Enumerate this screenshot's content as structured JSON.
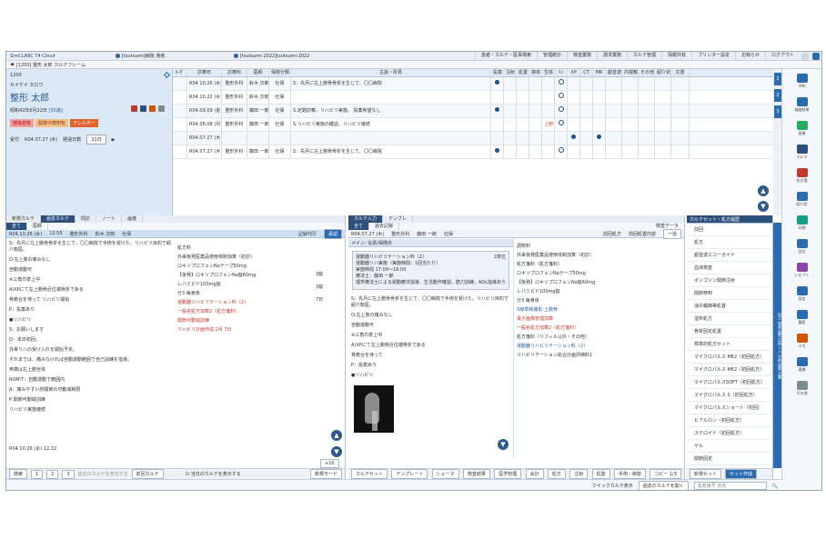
{
  "titlebar": {
    "app": "SimCLINIC T4 Cloud",
    "facility": "[tsutsumi]病院 港南",
    "tenant": "[tsutsumi-2022]tsutsumi-2022",
    "menus": [
      "患者・カルテ・医事検索",
      "管理統計",
      "検査業務",
      "請求業務",
      "カルテ管理",
      "情報共有",
      "プリンター設定",
      "お知らせ",
      "ログアウト"
    ]
  },
  "subbar": {
    "label": "[1200] 整形 太郎 カルテフレーム"
  },
  "patient": {
    "id": "1200",
    "kana": "セイケイ タロウ",
    "name": "整形 太郎",
    "dob": "昭和42年6月22日",
    "age": "[55歳]",
    "tags": [
      "感染症有",
      "服薬中薬剤有",
      "アレルギー"
    ],
    "visit_label": "受付",
    "visit_date": "R04.07.27 (木)",
    "days_label": "経過日数",
    "days": "31日"
  },
  "visits": {
    "headers": [
      "ｵｰﾀﾞ",
      "診療日",
      "診療科",
      "医師",
      "保険分類",
      "主訴・所見",
      "投薬",
      "注射",
      "処置",
      "検体",
      "生体",
      "ﾘﾊ",
      "XP",
      "CT",
      "MR",
      "超音波",
      "内視鏡",
      "その他",
      "紹介状",
      "文書"
    ],
    "rows": [
      {
        "date": "R04.10.26 (水)",
        "dept": "整形外科",
        "doctor": "鈴木 次郎",
        "ins": "社保",
        "note": "S：先月に左上腕骨骨折を生じて、〇〇病院",
        "marks": {
          "投薬": "dot",
          "ﾘﾊ": "ring"
        }
      },
      {
        "date": "R04.10.22 (水)",
        "dept": "整形外科",
        "doctor": "鈴木 次郎",
        "ins": "社保",
        "note": "",
        "marks": {
          "ﾘﾊ": "ring"
        }
      },
      {
        "date": "R04.09.09 (金)",
        "dept": "整形外科",
        "doctor": "藤田 一郎",
        "ins": "社保",
        "note": "S:定期診察。リハビリ実施。 投薬希望なし",
        "marks": {
          "投薬": "dot",
          "ﾘﾊ": "ring"
        }
      },
      {
        "date": "R04.08.08 (月)",
        "dept": "整形外科",
        "doctor": "藤田 一郎",
        "ins": "社保",
        "note": "S:リハビリ実施の確認。リハビリ継続",
        "marks": {
          "生体": "red",
          "ﾘﾊ": "ring"
        }
      },
      {
        "date": "R04.07.27 (木)",
        "dept": "",
        "doctor": "",
        "ins": "",
        "note": "",
        "marks": {
          "XP": "dot",
          "MR": "dot"
        }
      },
      {
        "date": "R04.07.27 (木)",
        "dept": "整形外科",
        "doctor": "藤田 一郎",
        "ins": "社保",
        "note": "S：先月に左上腕骨骨折を生じて、〇〇病院",
        "marks": {
          "投薬": "dot",
          "ﾘﾊ": "ring"
        }
      }
    ],
    "red_text": "上腕骨"
  },
  "leftpane": {
    "tabs": [
      "新規カルテ",
      "過去カルテ",
      "問診",
      "ノート",
      "画像"
    ],
    "subtabs": [
      "全て",
      "医師"
    ],
    "header": {
      "date": "R04.10.26 (水)",
      "time": "12:55",
      "dept": "整形外科",
      "doctor": "鈴木 次郎",
      "ins": "社保",
      "proxy": "記録代行",
      "stamp": "承認"
    },
    "soap": [
      "S：先月に左上腕骨骨折を生じて、〇〇病院で手術を受けた。リハビリ目的で紹介転医。",
      "O:左上肢の痛みなし",
      "自動運動可",
      "※三角巾挙上中",
      "A)XPにて左上腕骨近位端骨折である",
      "骨癒合を待って リハビリ開始",
      "P：投薬あり",
      "●リハビリ",
      "S：お願いします",
      "O：本日初回。",
      "外来リハの受け入れを開始予定。",
      "それまでは、痛みなければ自動運動範囲で自己訓練を指導。",
      "疼痛は左上腕全体",
      "ROM-T：自動運動で範囲内",
      "A：痛みやすい肘関節の可動域制限",
      "P:関節可動域訓練",
      "リハビリ実施継続"
    ],
    "orders": [
      "処方料",
      "外来後発医薬品使用体制加算（初診）",
      "ロキソプロフェンNaテープ50mg",
      "【後発】ロキソプロフェンNa錠60mg",
      "レバミピド100mg錠",
      "分3 毎食後",
      "運動器リハビリテーション料（2）",
      "一般名処方加算2（処方箋料）",
      "関節可動域訓練",
      "リハビリ計画作成 2月 7日"
    ],
    "order_counts": [
      "3錠",
      "3錠",
      "7日"
    ],
    "footer_date": "R04.10.26 (水) 12:22",
    "footer": [
      "検索",
      "1",
      "2",
      "3",
      "過去のカルテを表示する",
      "前回カルテ",
      "新規モード"
    ],
    "plus10": "+10",
    "checkbox": "当日のカルテを表示する"
  },
  "midpane": {
    "tabs": [
      "カルテ入力",
      "テンプレ"
    ],
    "subtabs": [
      "全て",
      "過去記録"
    ],
    "subtab_right": "検査データ",
    "header": {
      "date": "R04.07.27 (木)",
      "dept": "整形外科",
      "doctor": "藤田 一郎",
      "ins": "社保"
    },
    "header_right": [
      "前回処方",
      "前回処置内容",
      "一括"
    ],
    "accordion": "メイン: 伝票/保険外",
    "card": {
      "title": "運動器リハビリテーション料（2）",
      "count": "2単位",
      "lines": [
        "運動器リハ実施（実施時間：1回当たり）",
        "実施時間 17:00〜18:00",
        "療法士：藤田 一郎",
        "理学療法士による運動療法指導、生活動作確認、筋力訓練。ADL指導あり"
      ]
    },
    "soap": [
      "S：先月に左上腕骨骨折を生じて、〇〇病院で手術を受けた。リハビリ目的で紹介転医。",
      "O:左上肢の痛みなし",
      "自動運動可",
      "※三角巾挙上中",
      "A)XPにて左上腕骨近位端骨折である",
      "骨癒合を待って",
      "P：投薬あり",
      "●リハビリ"
    ],
    "right_orders": [
      "調剤料",
      "外来後発医薬品使用体制加算（初診）",
      "処方箋料（処方箋料）",
      "ロキソプロフェンNaテープ50mg",
      "【後発】ロキソプロフェンNa錠60mg",
      "レバミピド100mg錠",
      "分3 毎食後",
      "X線単純撮影 上腕骨",
      "電子画像管理加算",
      "一般名処方加算2（処方箋料）",
      "処方箋料（リフィル以外・その他）",
      "運動器リハビリテーション料（2）",
      "リハビリテーション総合計画評価料1"
    ],
    "footer": [
      "カルテセット",
      "テンプレート",
      "シェーマ",
      "検査結果",
      "医学管理",
      "会計",
      "処方",
      "注射",
      "処置",
      "手術・麻酔",
      "コピー 1/3"
    ]
  },
  "setpane": {
    "title": "カルテセット・処方履歴",
    "subtitle": "全て",
    "items": [
      "前回",
      "処方",
      "超音波エコーガイド",
      "血液検査",
      "ボンゴソン関節注射",
      "関節穿刺",
      "消炎鎮痛等処置",
      "湿布処方",
      "骨折固定処置",
      "標準的処方セット",
      "マイクロパルス ME2（初回処方）",
      "マイクロパルス ME2（初回処方）",
      "マイクロパルスSOFT（初回処方）",
      "マイクロパルス S（初回処方）",
      "マイクロパルスショート（初回）",
      "ヒアルロン（初回処方）",
      "ステロイド（初回処方）",
      "ゲル",
      "関節固定",
      "シャント抜去（クリーム）",
      "慢性疼痛",
      "介護保険"
    ],
    "footer_left": "新規セット",
    "footer_right": "セット作成",
    "pager": "ページ 1/3"
  },
  "rightnav": [
    "1",
    "2",
    "3"
  ],
  "vtabs": "処方 検査 処置 注射 リハ 手術 画像 文書",
  "tools": [
    "予約",
    "検査結果",
    "画像",
    "カルテ",
    "処方箋",
    "紹介状",
    "印刷",
    "会計",
    "レセプト",
    "設定",
    "履歴",
    "メモ",
    "連携",
    "その他"
  ],
  "bottom": {
    "left": "クイックカルテ表示",
    "right": "過去のカルテを開く",
    "search": "患者番号 氏名"
  },
  "colors": {
    "accent": "#2d5a8c",
    "tag_red": "#e3622d",
    "patient_bg": "#dbe9f7"
  }
}
